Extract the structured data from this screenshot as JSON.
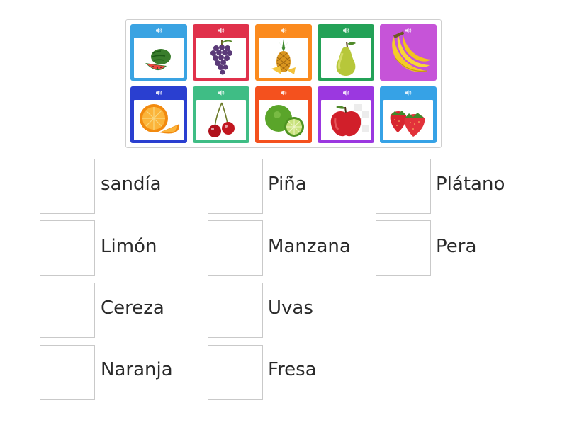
{
  "tray": {
    "tiles": [
      {
        "fruit": "watermelon",
        "icon": "watermelon-icon",
        "color": "#3aa3e2",
        "sound_icon": "speaker-icon"
      },
      {
        "fruit": "grapes",
        "icon": "grapes-icon",
        "color": "#e0314b",
        "sound_icon": "speaker-icon"
      },
      {
        "fruit": "pineapple",
        "icon": "pineapple-icon",
        "color": "#fb8a1e",
        "sound_icon": "speaker-icon"
      },
      {
        "fruit": "pear",
        "icon": "pear-icon",
        "color": "#23a257",
        "sound_icon": "speaker-icon"
      },
      {
        "fruit": "banana",
        "icon": "banana-icon",
        "color": "#c654d8",
        "sound_icon": "speaker-icon"
      },
      {
        "fruit": "orange",
        "icon": "orange-icon",
        "color": "#2a3fd0",
        "sound_icon": "speaker-icon"
      },
      {
        "fruit": "cherry",
        "icon": "cherry-icon",
        "color": "#3fbd85",
        "sound_icon": "speaker-icon"
      },
      {
        "fruit": "lime",
        "icon": "lime-icon",
        "color": "#f4511e",
        "sound_icon": "speaker-icon"
      },
      {
        "fruit": "apple",
        "icon": "apple-icon",
        "color": "#9b38e0",
        "sound_icon": "speaker-icon"
      },
      {
        "fruit": "strawberry",
        "icon": "strawberry-icon",
        "color": "#36a2e6",
        "sound_icon": "speaker-icon"
      }
    ]
  },
  "words": [
    {
      "label": "sandía"
    },
    {
      "label": "Piña"
    },
    {
      "label": "Plátano"
    },
    {
      "label": "Limón"
    },
    {
      "label": "Manzana"
    },
    {
      "label": "Pera"
    },
    {
      "label": "Cereza"
    },
    {
      "label": "Uvas"
    },
    {
      "label": "Naranja"
    },
    {
      "label": "Fresa"
    }
  ]
}
